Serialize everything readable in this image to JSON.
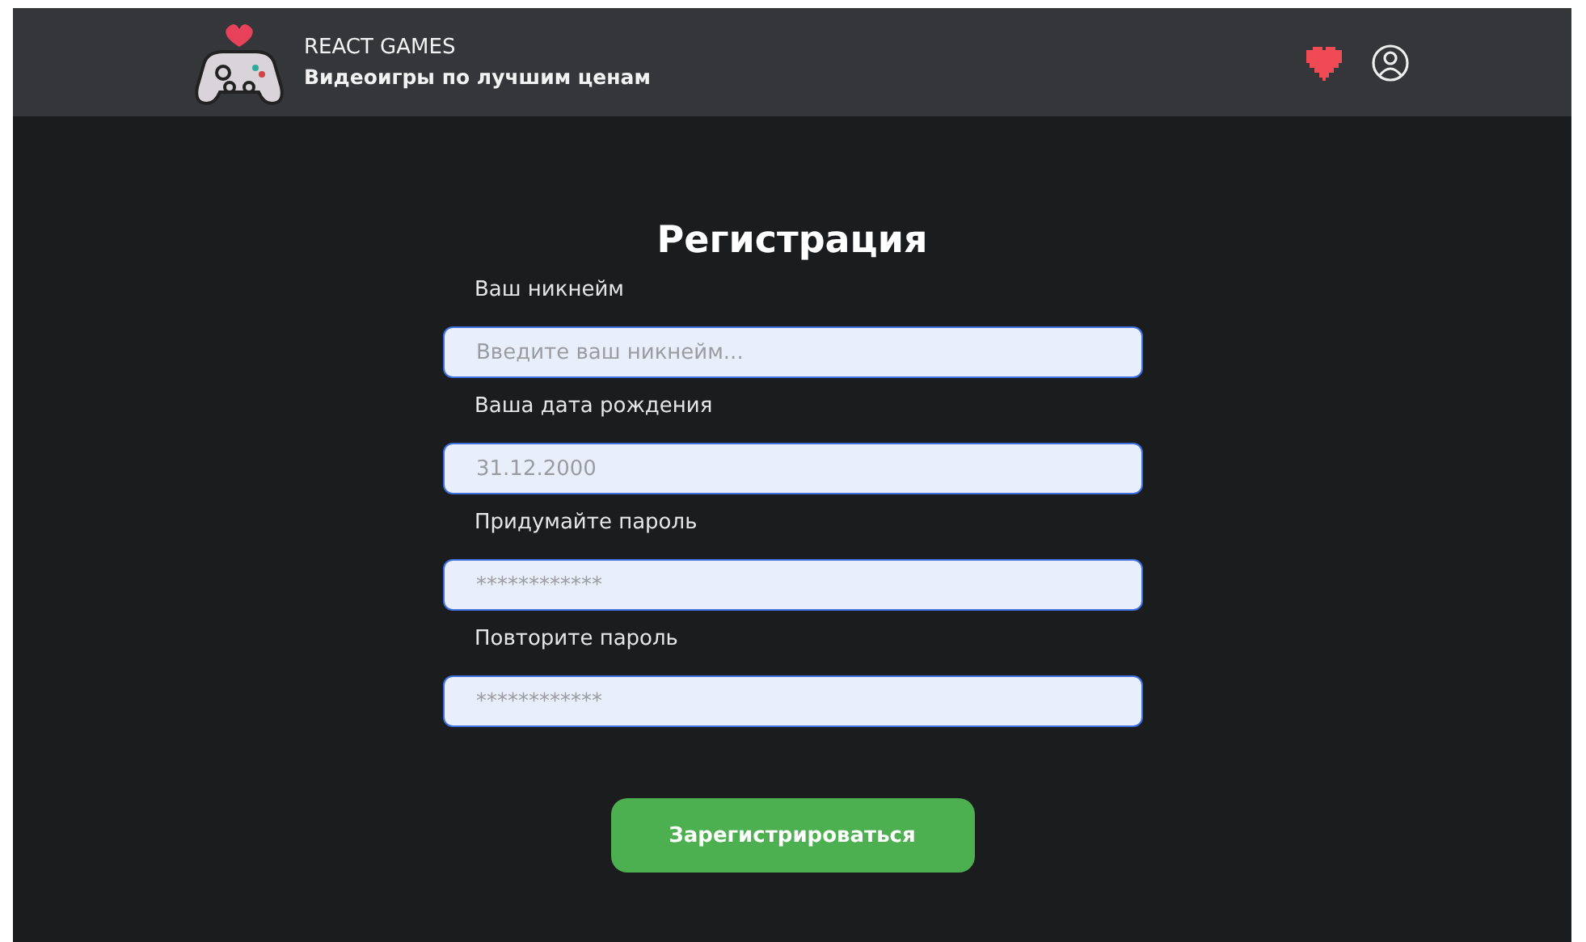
{
  "header": {
    "brand": "REACT GAMES",
    "tagline": "Видеоигры по лучшим ценам"
  },
  "form": {
    "title": "Регистрация",
    "fields": [
      {
        "label": "Ваш никнейм",
        "placeholder": "Введите ваш никнейм..."
      },
      {
        "label": "Ваша дата рождения",
        "placeholder": "31.12.2000"
      },
      {
        "label": "Придумайте пароль",
        "placeholder": "************"
      },
      {
        "label": "Повторите пароль",
        "placeholder": "************"
      }
    ],
    "submit": "Зарегистрироваться"
  }
}
